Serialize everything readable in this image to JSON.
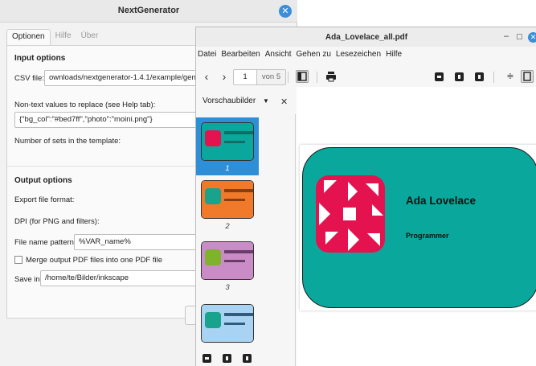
{
  "generator": {
    "title": "NextGenerator",
    "tabs": [
      {
        "label": "Optionen"
      },
      {
        "label": "Hilfe"
      },
      {
        "label": "Über"
      }
    ],
    "input_options_heading": "Input options",
    "csv_label": "CSV file:",
    "csv_value": "ownloads/nextgenerator-1.4.1/example/gene",
    "nontext_label": "Non-text values to replace (see Help tab):",
    "nontext_value": "{\"bg_col\":\"#bed7ff\",\"photo\":\"moini.png\"}",
    "sets_label": "Number of sets in the template:",
    "output_options_heading": "Output options",
    "export_label": "Export file format:",
    "dpi_label": "DPI (for PNG and filters):",
    "pattern_label": "File name pattern:",
    "pattern_value": "%VAR_name%",
    "merge_label": "Merge output PDF files into one PDF file",
    "save_label": "Save in:",
    "save_value": "/home/te/Bilder/inkscape"
  },
  "viewer": {
    "title": "Ada_Lovelace_all.pdf",
    "menu": [
      {
        "label": "Datei"
      },
      {
        "label": "Bearbeiten"
      },
      {
        "label": "Ansicht"
      },
      {
        "label": "Gehen zu"
      },
      {
        "label": "Lesezeichen"
      },
      {
        "label": "Hilfe"
      }
    ],
    "page_value": "1",
    "page_of": "von 5",
    "thumb_selector_label": "Vorschaubilder",
    "thumbnails": [
      {
        "number": "1",
        "card_color": "#0aa89c",
        "logo_color": "#e4134f"
      },
      {
        "number": "2",
        "card_color": "#f07a2a",
        "logo_color": "#1aa38c"
      },
      {
        "number": "3",
        "card_color": "#c98cc6",
        "logo_color": "#7fb32b"
      },
      {
        "number": "",
        "card_color": "#a9d3f2",
        "logo_color": "#1aa38c"
      }
    ],
    "card": {
      "name": "Ada Lovelace",
      "role": "Programmer",
      "background": "#0aa89c",
      "logo_color": "#e4134f"
    }
  }
}
